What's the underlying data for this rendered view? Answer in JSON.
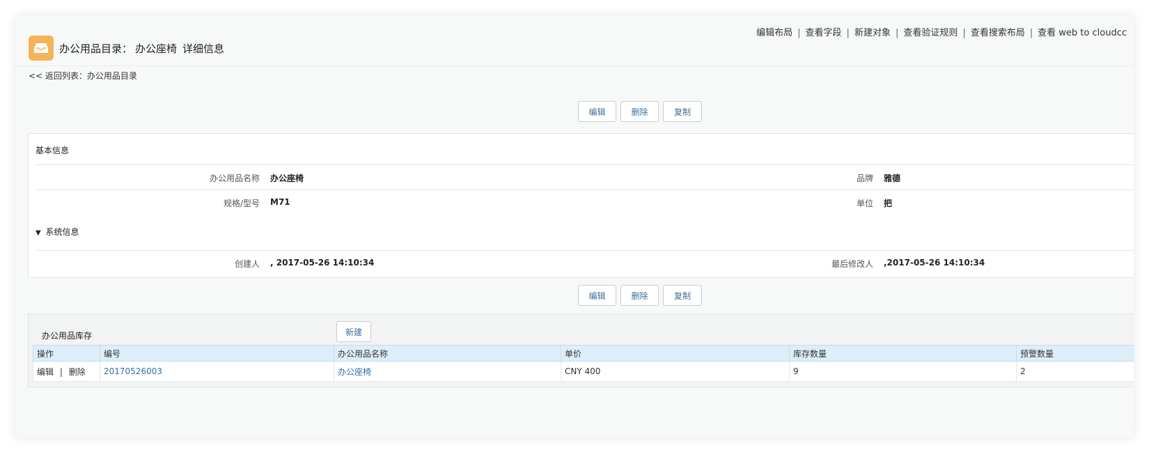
{
  "top_links": [
    "编辑布局",
    "查看字段",
    "新建对象",
    "查看验证规则",
    "查看搜索布局",
    "查看 web to cloudcc"
  ],
  "header": {
    "icon": "tray-icon",
    "title": "办公用品目录：",
    "subtitle": "办公座椅",
    "suffix": "详细信息"
  },
  "back_link": "<< 返回列表：办公用品目录",
  "actions": {
    "edit": "编辑",
    "delete": "删除",
    "copy": "复制"
  },
  "basic_info": {
    "section_title": "基本信息",
    "fields": [
      {
        "label": "办公用品名称",
        "value": "办公座椅"
      },
      {
        "label": "品牌",
        "value": "雅德"
      },
      {
        "label": "规格/型号",
        "value": "M71"
      },
      {
        "label": "单位",
        "value": "把"
      }
    ]
  },
  "system_info": {
    "section_title": "系统信息",
    "toggle": "▼",
    "fields": [
      {
        "label": "创建人",
        "value": ", 2017-05-26 14:10:34"
      },
      {
        "label": "最后修改人",
        "value": ",2017-05-26 14:10:34"
      }
    ]
  },
  "related": {
    "title": "办公用品库存",
    "new_button": "新建",
    "columns": [
      "操作",
      "编号",
      "办公用品名称",
      "单价",
      "库存数量",
      "预警数量"
    ],
    "rows": [
      {
        "edit": "编辑",
        "sep": "|",
        "delete": "删除",
        "number": "20170526003",
        "name": "办公座椅",
        "price": "CNY 400",
        "stock": "9",
        "warning": "2"
      }
    ]
  },
  "colors": {
    "accent_icon": "#f5b35a",
    "link": "#2e6fb0",
    "table_header": "#ddeef8"
  }
}
